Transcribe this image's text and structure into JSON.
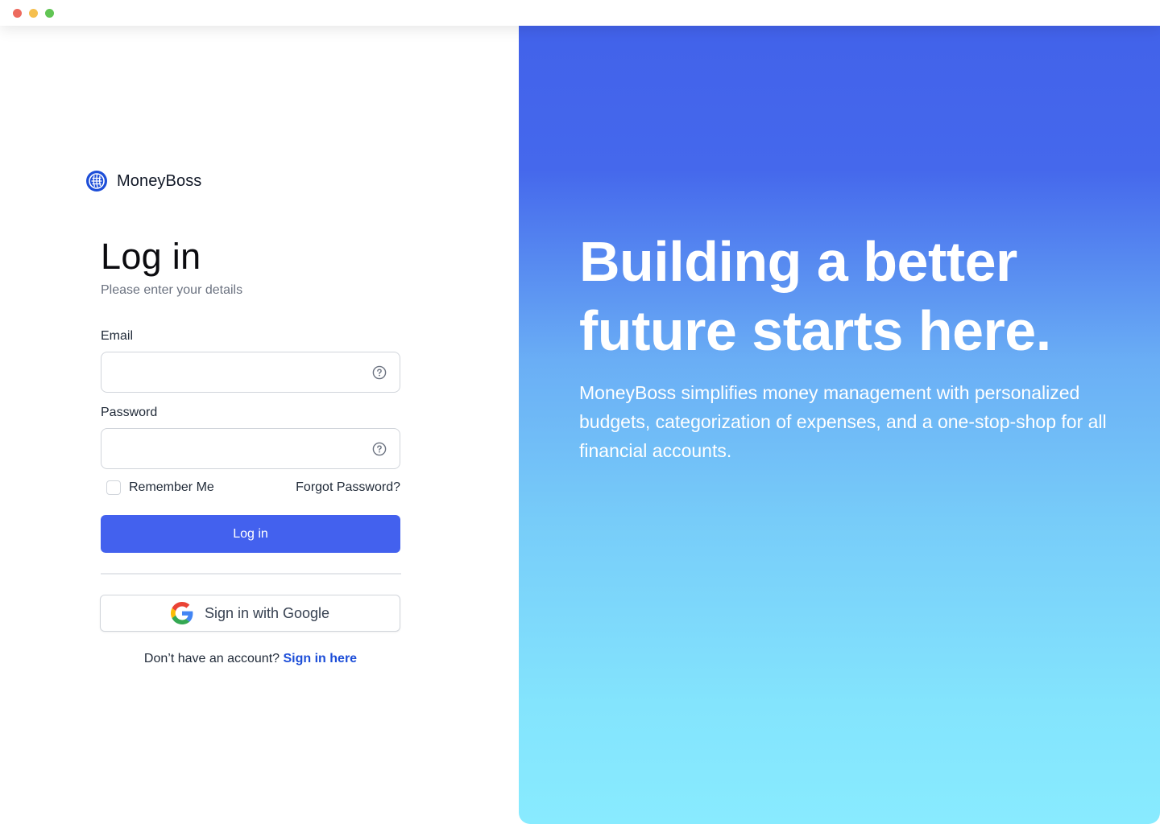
{
  "window": {
    "controls": [
      "close",
      "minimize",
      "maximize"
    ]
  },
  "brand": {
    "name": "MoneyBoss",
    "logo_icon": "globe-grid-icon",
    "accent_color": "#1d4ed8"
  },
  "login": {
    "title": "Log in",
    "subtitle": "Please enter your details",
    "email": {
      "label": "Email",
      "value": "",
      "placeholder": "",
      "help_icon": "question-circle-icon"
    },
    "password": {
      "label": "Password",
      "value": "",
      "placeholder": "",
      "help_icon": "question-circle-icon"
    },
    "remember_label": "Remember Me",
    "remember_checked": false,
    "forgot_label": "Forgot Password?",
    "submit_label": "Log in",
    "submit_color": "#4361ee",
    "google_label": "Sign in with Google",
    "google_icon": "google-g-icon",
    "signup_prompt": "Don’t have an account?",
    "signup_link": "Sign in here"
  },
  "hero": {
    "headline": "Building a better future starts here.",
    "body": "MoneyBoss simplifies money management with personalized budgets, categorization of expenses, and a one-stop-shop for all financial accounts.",
    "gradient_top": "#4262ea",
    "gradient_bottom": "#88ebff"
  }
}
